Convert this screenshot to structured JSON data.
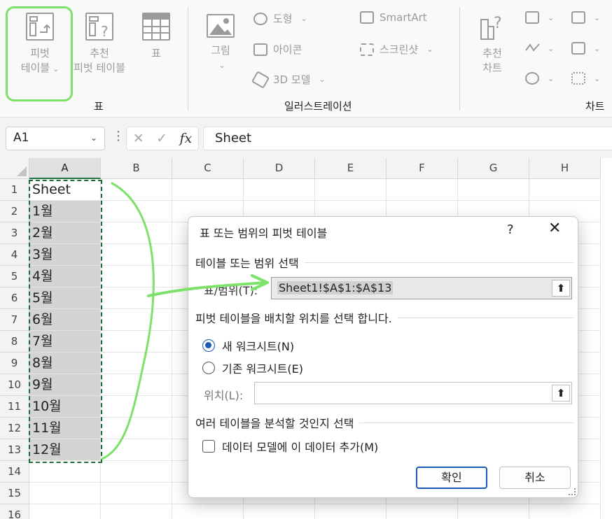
{
  "ribbon": {
    "pivot": {
      "line1": "피벗",
      "line2": "테이블"
    },
    "recommended": {
      "line1": "추천",
      "line2": "피벗 테이블"
    },
    "table": "표",
    "picture": "그림",
    "shapes": "도형",
    "icons": "아이콘",
    "models3d": "3D 모델",
    "smartart": "SmartArt",
    "screenshot": "스크린샷",
    "recommended_charts": {
      "line1": "추천",
      "line2": "차트"
    },
    "group_tables": "표",
    "group_illustrations": "일러스트레이션",
    "group_charts": "차트"
  },
  "formula_bar": {
    "name_box": "A1",
    "content": "Sheet"
  },
  "grid": {
    "columns": [
      "A",
      "B",
      "C",
      "D",
      "E",
      "F",
      "G",
      "H"
    ],
    "rows": [
      "1",
      "2",
      "3",
      "4",
      "5",
      "6",
      "7",
      "8",
      "9",
      "10",
      "11",
      "12",
      "13",
      "14",
      "15",
      "16"
    ],
    "colA": [
      "Sheet",
      "1월",
      "2월",
      "3월",
      "4월",
      "5월",
      "6월",
      "7월",
      "8월",
      "9월",
      "10월",
      "11월",
      "12월"
    ]
  },
  "dialog": {
    "title": "표 또는 범위의 피벗 테이블",
    "help": "?",
    "close": "✕",
    "section1": "테이블 또는 범위 선택",
    "range_label": "표/범위(T):",
    "range_value": "Sheet1!$A$1:$A$13",
    "section2": "피벗 테이블을 배치할 위치를 선택 합니다.",
    "radio_new": "새 워크시트(N)",
    "radio_existing": "기존 워크시트(E)",
    "location_label": "위치(L):",
    "location_value": "",
    "section3": "여러 테이블을 분석할 것인지 선택",
    "datamodel": "데이터 모델에 이 데이터 추가(M)",
    "ok": "확인",
    "cancel": "취소",
    "upload_icon": "⬆"
  },
  "colors": {
    "highlight": "#7ee26a",
    "accent": "#1b5bb6",
    "selection": "#d4d4d4",
    "marquee": "#1f6b3a"
  }
}
